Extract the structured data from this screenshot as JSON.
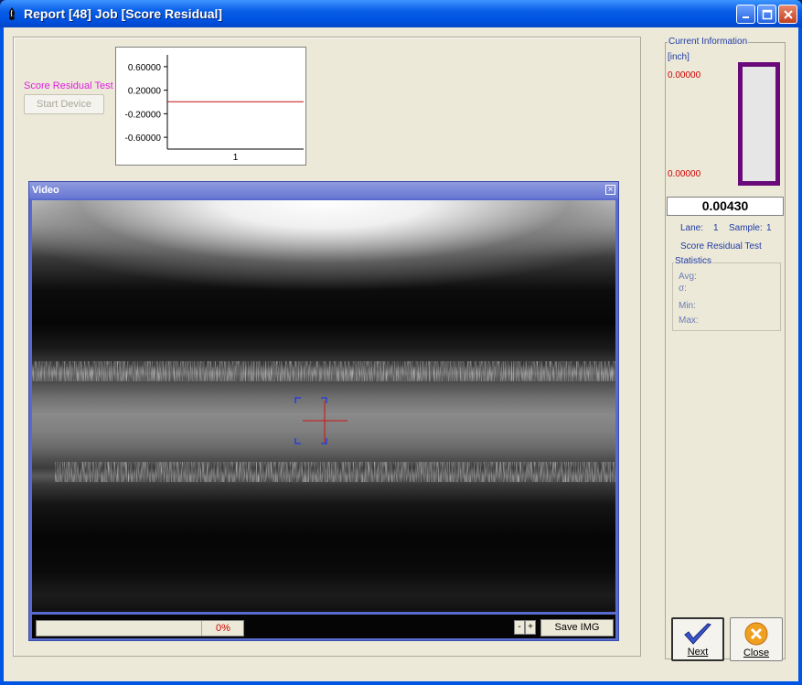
{
  "window": {
    "title": "Report [48] Job [Score Residual]"
  },
  "controls": {
    "score_label": "Score Residual Test",
    "start_button": "Start Device"
  },
  "mini_chart": {
    "y_ticks": [
      "0.60000",
      "0.20000",
      "-0.20000",
      "-0.60000"
    ],
    "x_tick": "1"
  },
  "chart_data": {
    "type": "line",
    "x": [
      1
    ],
    "series": [
      {
        "values": [
          0.0043
        ]
      }
    ],
    "ylim": [
      -0.8,
      0.8
    ]
  },
  "video": {
    "title": "Video",
    "progress_text": "0%",
    "minus": "-",
    "plus": "+",
    "save_label": "Save IMG"
  },
  "current_info": {
    "legend": "Current Information",
    "unit": "[inch]",
    "gauge_high": "0.00000",
    "gauge_low": "0.00000",
    "value": "0.00430",
    "lane_label": "Lane:",
    "lane_value": "1",
    "sample_label": "Sample:",
    "sample_value": "1",
    "test_name": "Score Residual Test"
  },
  "statistics": {
    "legend": "Statistics",
    "avg": "Avg:",
    "sigma": "σ:",
    "min": "Min:",
    "max": "Max:"
  },
  "buttons": {
    "next": "Next",
    "close": "Close"
  },
  "colors": {
    "gauge_border": "#6a0a7a",
    "value_red": "#d00000",
    "label_blue": "#1f3ba6",
    "magenta": "#e020e0"
  }
}
